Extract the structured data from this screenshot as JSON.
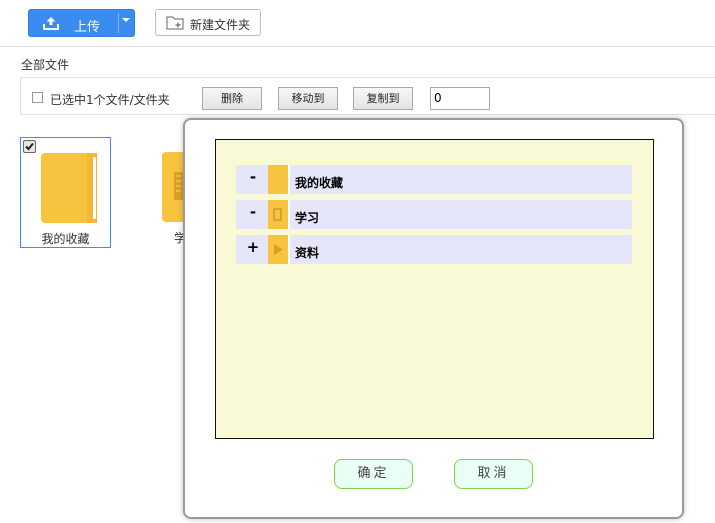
{
  "toolbar": {
    "upload_label": "上传",
    "new_folder_label": "新建文件夹"
  },
  "breadcrumb": "全部文件",
  "selection_bar": {
    "selected_text": "已选中1个文件/文件夹",
    "delete_label": "删除",
    "move_label": "移动到",
    "copy_label": "复制到",
    "input_value": "0"
  },
  "files": [
    {
      "name": "我的收藏",
      "selected": true
    },
    {
      "name": "学"
    }
  ],
  "dialog": {
    "tree": [
      {
        "toggle": "-",
        "label": "我的收藏",
        "icon": "folder-icon"
      },
      {
        "toggle": "-",
        "label": "学习",
        "icon": "document-folder-icon"
      },
      {
        "toggle": "+",
        "label": "资料",
        "icon": "play-folder-icon"
      }
    ],
    "ok_label": "确定",
    "cancel_label": "取消"
  },
  "colors": {
    "accent": "#3b8cf0",
    "folder": "#f8c440",
    "tree_bg": "#f9f9d6",
    "tree_row": "#e6e6fa",
    "dialog_button_border": "#7cd64a"
  }
}
